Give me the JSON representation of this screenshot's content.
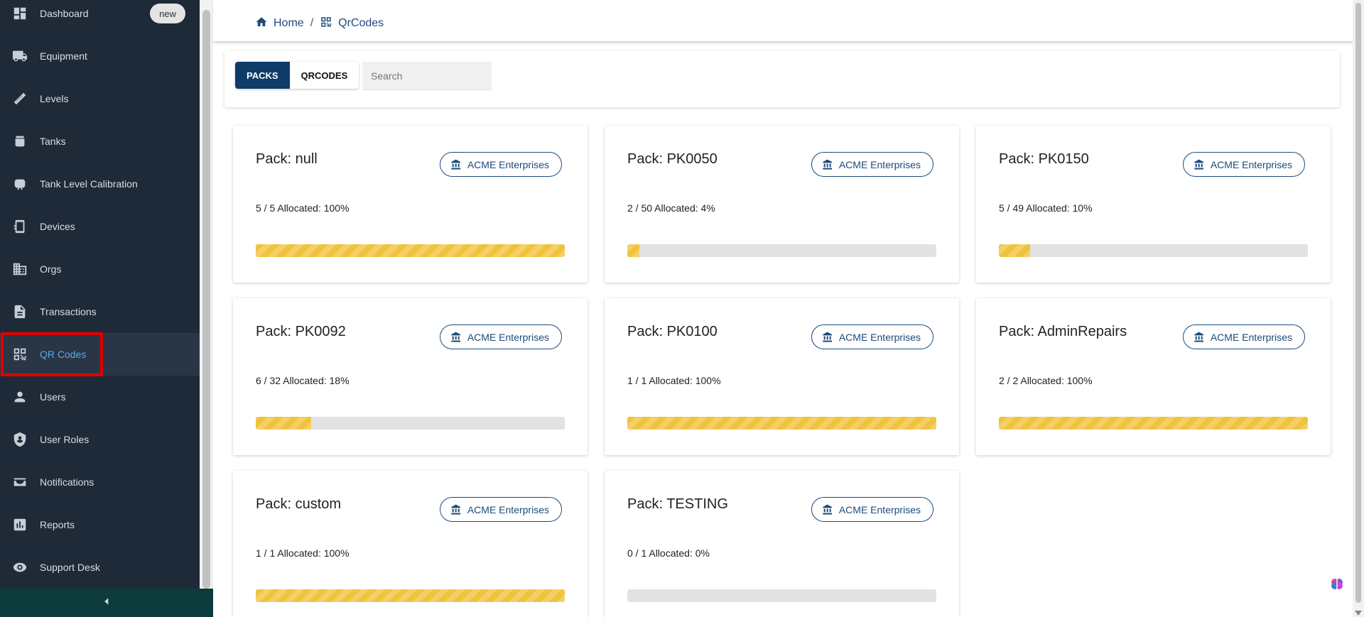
{
  "sidebar": {
    "items": [
      {
        "label": "Dashboard",
        "icon": "dashboard-icon",
        "badge": "new"
      },
      {
        "label": "Equipment",
        "icon": "truck-icon"
      },
      {
        "label": "Levels",
        "icon": "ruler-icon"
      },
      {
        "label": "Tanks",
        "icon": "tank-icon"
      },
      {
        "label": "Tank Level Calibration",
        "icon": "calibration-icon"
      },
      {
        "label": "Devices",
        "icon": "device-icon"
      },
      {
        "label": "Orgs",
        "icon": "building-icon"
      },
      {
        "label": "Transactions",
        "icon": "document-icon"
      },
      {
        "label": "QR Codes",
        "icon": "qr-code-icon",
        "active": true
      },
      {
        "label": "Users",
        "icon": "person-icon"
      },
      {
        "label": "User Roles",
        "icon": "shield-icon"
      },
      {
        "label": "Notifications",
        "icon": "inbox-icon"
      },
      {
        "label": "Reports",
        "icon": "bar-chart-icon"
      },
      {
        "label": "Support Desk",
        "icon": "support-icon"
      }
    ],
    "collapse_icon": "chevron-left-icon"
  },
  "breadcrumb": {
    "home": "Home",
    "separator": "/",
    "current": "QrCodes"
  },
  "toolbar": {
    "tabs": [
      {
        "label": "PACKS",
        "active": true
      },
      {
        "label": "QRCODES",
        "active": false
      }
    ],
    "search_placeholder": "Search"
  },
  "packs": [
    {
      "title": "Pack: null",
      "org": "ACME Enterprises",
      "allocation": "5 / 5 Allocated: 100%",
      "percent": 100
    },
    {
      "title": "Pack: PK0050",
      "org": "ACME Enterprises",
      "allocation": "2 / 50 Allocated: 4%",
      "percent": 4
    },
    {
      "title": "Pack: PK0150",
      "org": "ACME Enterprises",
      "allocation": "5 / 49 Allocated: 10%",
      "percent": 10
    },
    {
      "title": "Pack: PK0092",
      "org": "ACME Enterprises",
      "allocation": "6 / 32 Allocated: 18%",
      "percent": 18
    },
    {
      "title": "Pack: PK0100",
      "org": "ACME Enterprises",
      "allocation": "1 / 1 Allocated: 100%",
      "percent": 100
    },
    {
      "title": "Pack: AdminRepairs",
      "org": "ACME Enterprises",
      "allocation": "2 / 2 Allocated: 100%",
      "percent": 100
    },
    {
      "title": "Pack: custom",
      "org": "ACME Enterprises",
      "allocation": "1 / 1 Allocated: 100%",
      "percent": 100
    },
    {
      "title": "Pack: TESTING",
      "org": "ACME Enterprises",
      "allocation": "0 / 1 Allocated: 0%",
      "percent": 0
    }
  ],
  "colors": {
    "sidebar_bg": "#1f2a38",
    "primary": "#0f3b68",
    "progress_fill": "#f0c33c",
    "active_link": "#5aa9e6",
    "highlight": "#e00000"
  }
}
